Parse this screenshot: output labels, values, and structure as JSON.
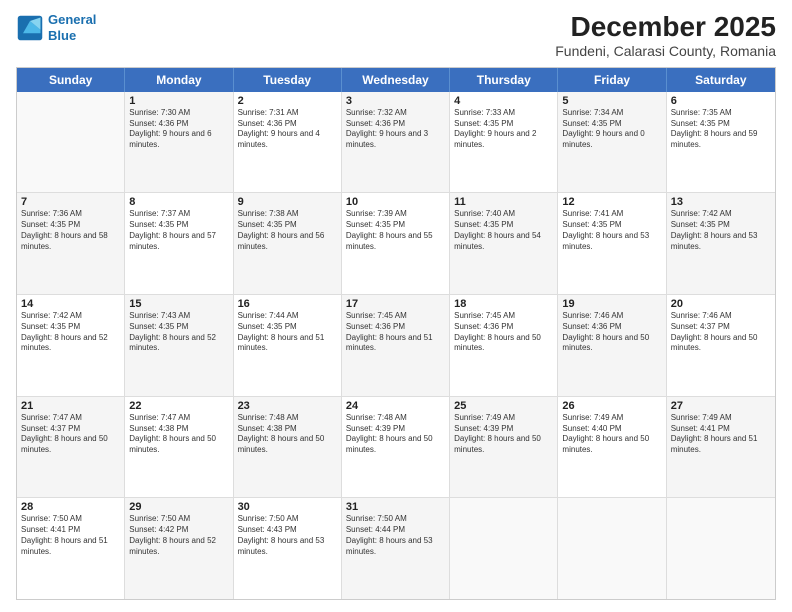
{
  "logo": {
    "line1": "General",
    "line2": "Blue"
  },
  "title": "December 2025",
  "subtitle": "Fundeni, Calarasi County, Romania",
  "weekdays": [
    "Sunday",
    "Monday",
    "Tuesday",
    "Wednesday",
    "Thursday",
    "Friday",
    "Saturday"
  ],
  "rows": [
    [
      {
        "day": "",
        "empty": true
      },
      {
        "day": "1",
        "sunrise": "Sunrise: 7:30 AM",
        "sunset": "Sunset: 4:36 PM",
        "daylight": "Daylight: 9 hours and 6 minutes."
      },
      {
        "day": "2",
        "sunrise": "Sunrise: 7:31 AM",
        "sunset": "Sunset: 4:36 PM",
        "daylight": "Daylight: 9 hours and 4 minutes."
      },
      {
        "day": "3",
        "sunrise": "Sunrise: 7:32 AM",
        "sunset": "Sunset: 4:36 PM",
        "daylight": "Daylight: 9 hours and 3 minutes."
      },
      {
        "day": "4",
        "sunrise": "Sunrise: 7:33 AM",
        "sunset": "Sunset: 4:35 PM",
        "daylight": "Daylight: 9 hours and 2 minutes."
      },
      {
        "day": "5",
        "sunrise": "Sunrise: 7:34 AM",
        "sunset": "Sunset: 4:35 PM",
        "daylight": "Daylight: 9 hours and 0 minutes."
      },
      {
        "day": "6",
        "sunrise": "Sunrise: 7:35 AM",
        "sunset": "Sunset: 4:35 PM",
        "daylight": "Daylight: 8 hours and 59 minutes."
      }
    ],
    [
      {
        "day": "7",
        "sunrise": "Sunrise: 7:36 AM",
        "sunset": "Sunset: 4:35 PM",
        "daylight": "Daylight: 8 hours and 58 minutes."
      },
      {
        "day": "8",
        "sunrise": "Sunrise: 7:37 AM",
        "sunset": "Sunset: 4:35 PM",
        "daylight": "Daylight: 8 hours and 57 minutes."
      },
      {
        "day": "9",
        "sunrise": "Sunrise: 7:38 AM",
        "sunset": "Sunset: 4:35 PM",
        "daylight": "Daylight: 8 hours and 56 minutes."
      },
      {
        "day": "10",
        "sunrise": "Sunrise: 7:39 AM",
        "sunset": "Sunset: 4:35 PM",
        "daylight": "Daylight: 8 hours and 55 minutes."
      },
      {
        "day": "11",
        "sunrise": "Sunrise: 7:40 AM",
        "sunset": "Sunset: 4:35 PM",
        "daylight": "Daylight: 8 hours and 54 minutes."
      },
      {
        "day": "12",
        "sunrise": "Sunrise: 7:41 AM",
        "sunset": "Sunset: 4:35 PM",
        "daylight": "Daylight: 8 hours and 53 minutes."
      },
      {
        "day": "13",
        "sunrise": "Sunrise: 7:42 AM",
        "sunset": "Sunset: 4:35 PM",
        "daylight": "Daylight: 8 hours and 53 minutes."
      }
    ],
    [
      {
        "day": "14",
        "sunrise": "Sunrise: 7:42 AM",
        "sunset": "Sunset: 4:35 PM",
        "daylight": "Daylight: 8 hours and 52 minutes."
      },
      {
        "day": "15",
        "sunrise": "Sunrise: 7:43 AM",
        "sunset": "Sunset: 4:35 PM",
        "daylight": "Daylight: 8 hours and 52 minutes."
      },
      {
        "day": "16",
        "sunrise": "Sunrise: 7:44 AM",
        "sunset": "Sunset: 4:35 PM",
        "daylight": "Daylight: 8 hours and 51 minutes."
      },
      {
        "day": "17",
        "sunrise": "Sunrise: 7:45 AM",
        "sunset": "Sunset: 4:36 PM",
        "daylight": "Daylight: 8 hours and 51 minutes."
      },
      {
        "day": "18",
        "sunrise": "Sunrise: 7:45 AM",
        "sunset": "Sunset: 4:36 PM",
        "daylight": "Daylight: 8 hours and 50 minutes."
      },
      {
        "day": "19",
        "sunrise": "Sunrise: 7:46 AM",
        "sunset": "Sunset: 4:36 PM",
        "daylight": "Daylight: 8 hours and 50 minutes."
      },
      {
        "day": "20",
        "sunrise": "Sunrise: 7:46 AM",
        "sunset": "Sunset: 4:37 PM",
        "daylight": "Daylight: 8 hours and 50 minutes."
      }
    ],
    [
      {
        "day": "21",
        "sunrise": "Sunrise: 7:47 AM",
        "sunset": "Sunset: 4:37 PM",
        "daylight": "Daylight: 8 hours and 50 minutes."
      },
      {
        "day": "22",
        "sunrise": "Sunrise: 7:47 AM",
        "sunset": "Sunset: 4:38 PM",
        "daylight": "Daylight: 8 hours and 50 minutes."
      },
      {
        "day": "23",
        "sunrise": "Sunrise: 7:48 AM",
        "sunset": "Sunset: 4:38 PM",
        "daylight": "Daylight: 8 hours and 50 minutes."
      },
      {
        "day": "24",
        "sunrise": "Sunrise: 7:48 AM",
        "sunset": "Sunset: 4:39 PM",
        "daylight": "Daylight: 8 hours and 50 minutes."
      },
      {
        "day": "25",
        "sunrise": "Sunrise: 7:49 AM",
        "sunset": "Sunset: 4:39 PM",
        "daylight": "Daylight: 8 hours and 50 minutes."
      },
      {
        "day": "26",
        "sunrise": "Sunrise: 7:49 AM",
        "sunset": "Sunset: 4:40 PM",
        "daylight": "Daylight: 8 hours and 50 minutes."
      },
      {
        "day": "27",
        "sunrise": "Sunrise: 7:49 AM",
        "sunset": "Sunset: 4:41 PM",
        "daylight": "Daylight: 8 hours and 51 minutes."
      }
    ],
    [
      {
        "day": "28",
        "sunrise": "Sunrise: 7:50 AM",
        "sunset": "Sunset: 4:41 PM",
        "daylight": "Daylight: 8 hours and 51 minutes."
      },
      {
        "day": "29",
        "sunrise": "Sunrise: 7:50 AM",
        "sunset": "Sunset: 4:42 PM",
        "daylight": "Daylight: 8 hours and 52 minutes."
      },
      {
        "day": "30",
        "sunrise": "Sunrise: 7:50 AM",
        "sunset": "Sunset: 4:43 PM",
        "daylight": "Daylight: 8 hours and 53 minutes."
      },
      {
        "day": "31",
        "sunrise": "Sunrise: 7:50 AM",
        "sunset": "Sunset: 4:44 PM",
        "daylight": "Daylight: 8 hours and 53 minutes."
      },
      {
        "day": "",
        "empty": true
      },
      {
        "day": "",
        "empty": true
      },
      {
        "day": "",
        "empty": true
      }
    ]
  ]
}
